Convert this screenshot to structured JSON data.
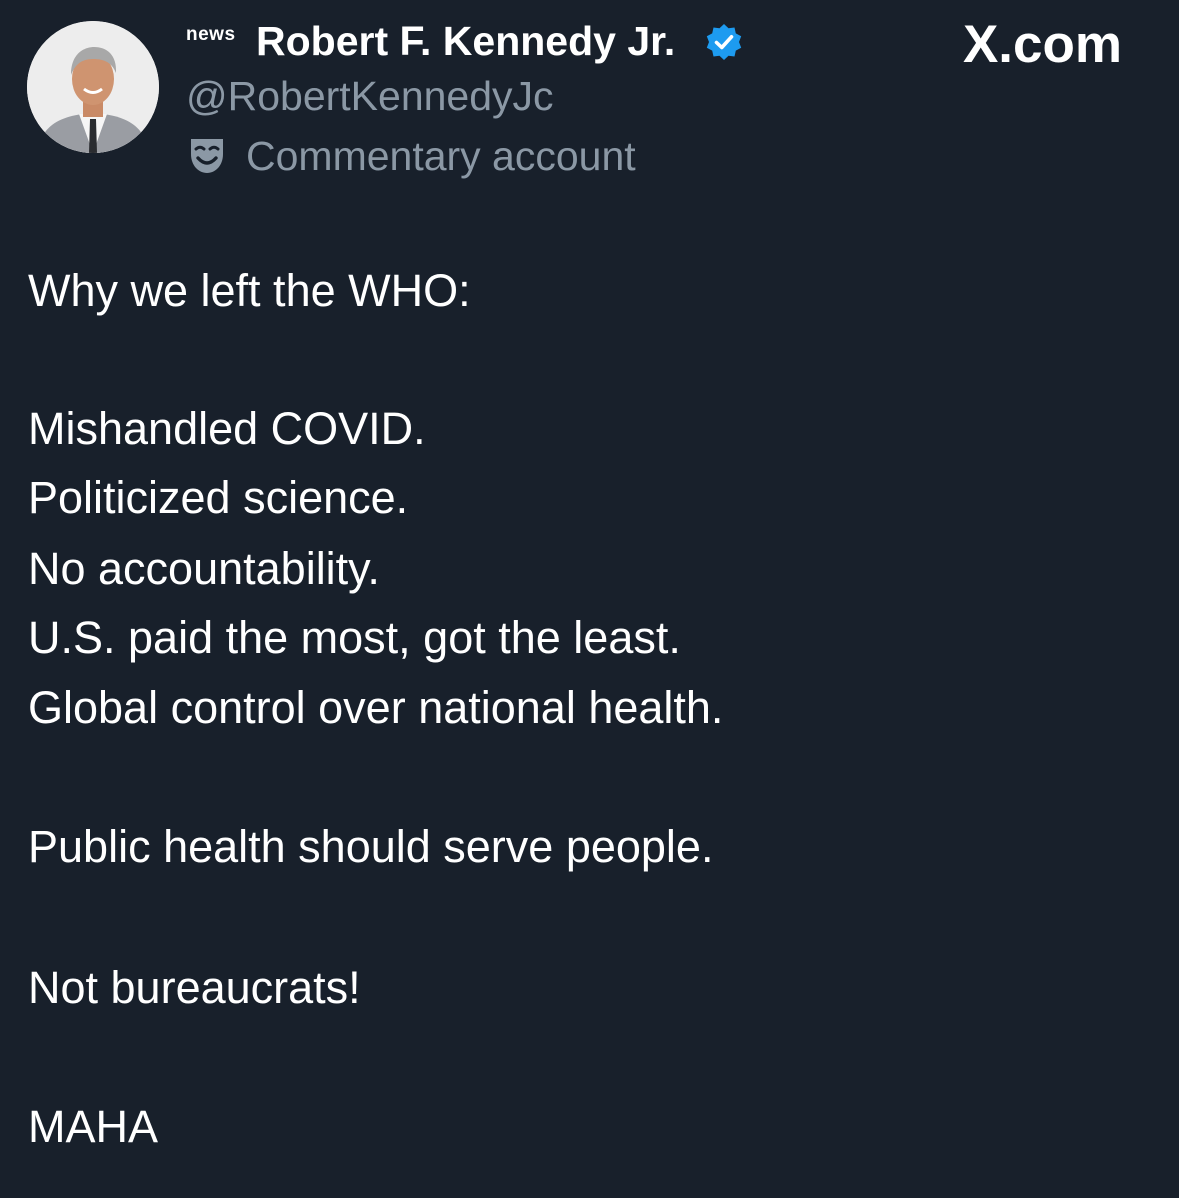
{
  "author": {
    "badge": "news",
    "display_name": "Robert F. Kennedy Jr.",
    "handle": "@RobertKennedyJc",
    "account_label": "Commentary account",
    "verified": true,
    "verified_color": "#1d9bf0"
  },
  "site": {
    "brand": "X.com"
  },
  "tweet": {
    "lines": [
      "Why we left the WHO:",
      "Mishandled COVID.",
      "Politicized science.",
      "No accountability.",
      "U.S. paid the most, got the least.",
      "Global control over national health.",
      "Public health should serve people.",
      "Not bureaucrats!",
      "MAHA"
    ]
  },
  "colors": {
    "background": "#18202b",
    "text": "#ffffff",
    "secondary_text": "#8b98a5"
  }
}
